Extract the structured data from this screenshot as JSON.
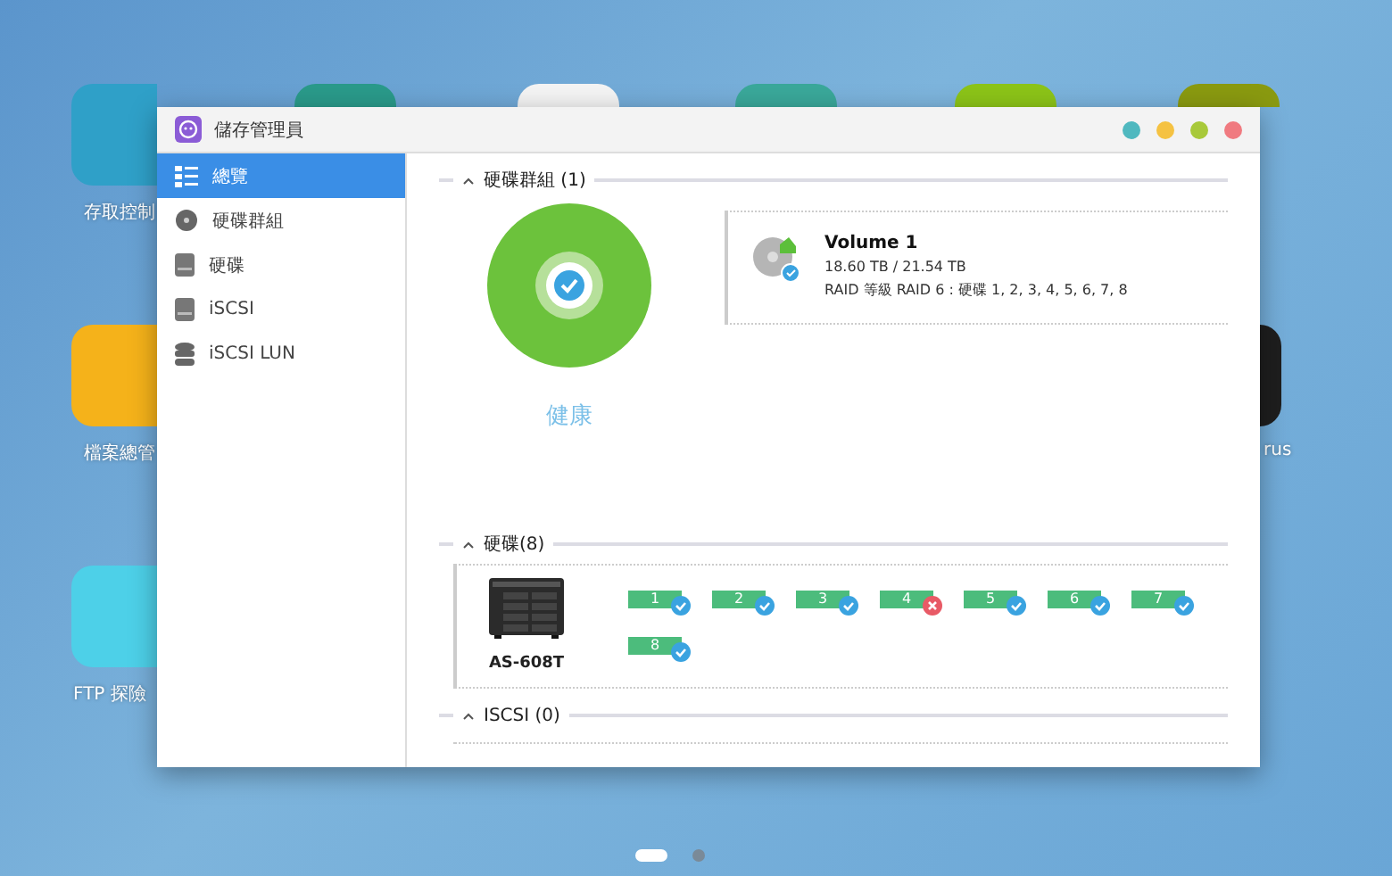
{
  "desktop": {
    "icons": [
      {
        "label": "存取控制",
        "color": "#2fa0c8"
      },
      {
        "label": "檔案總管",
        "color": "#f5b21a"
      },
      {
        "label": "FTP 探險",
        "color": "#4dd0e8"
      },
      {
        "color": "#2a9a8a"
      },
      {
        "color": "#f4f4f4"
      },
      {
        "color": "#3aa89a"
      },
      {
        "color": "#8cc418"
      },
      {
        "color": "#8a9a10"
      },
      {
        "label": "rus",
        "color": "#1e1e1e"
      }
    ],
    "page_dots": [
      {
        "selected": true
      },
      {
        "selected": false
      }
    ]
  },
  "window": {
    "title": "儲存管理員",
    "controls": [
      {
        "color": "#4fb8bf"
      },
      {
        "color": "#f5c242"
      },
      {
        "color": "#a8c93a"
      },
      {
        "color": "#f07a80"
      }
    ]
  },
  "sidebar": {
    "items": [
      {
        "label": "總覽",
        "selected": true,
        "kind": "overview"
      },
      {
        "label": "硬碟群組",
        "selected": false,
        "kind": "volume"
      },
      {
        "label": "硬碟",
        "selected": false,
        "kind": "disk"
      },
      {
        "label": "iSCSI",
        "selected": false,
        "kind": "iscsi"
      },
      {
        "label": "iSCSI LUN",
        "selected": false,
        "kind": "lun"
      }
    ]
  },
  "volume_groups": {
    "title": "硬碟群組 (1)",
    "status": "健康",
    "volume": {
      "name": "Volume 1",
      "capacity": "18.60 TB / 21.54 TB",
      "raid": "RAID 等級 RAID 6 : 硬碟 1, 2, 3, 4, 5, 6, 7, 8"
    }
  },
  "disks": {
    "title": "硬碟(8)",
    "device": "AS-608T",
    "items": [
      {
        "label": "1",
        "healthy": true
      },
      {
        "label": "2",
        "healthy": true
      },
      {
        "label": "3",
        "healthy": true
      },
      {
        "label": "4",
        "healthy": false
      },
      {
        "label": "5",
        "healthy": true
      },
      {
        "label": "6",
        "healthy": true
      },
      {
        "label": "7",
        "healthy": true
      },
      {
        "label": "8",
        "healthy": true
      }
    ]
  },
  "iscsi": {
    "title": "ISCSI (0)"
  }
}
